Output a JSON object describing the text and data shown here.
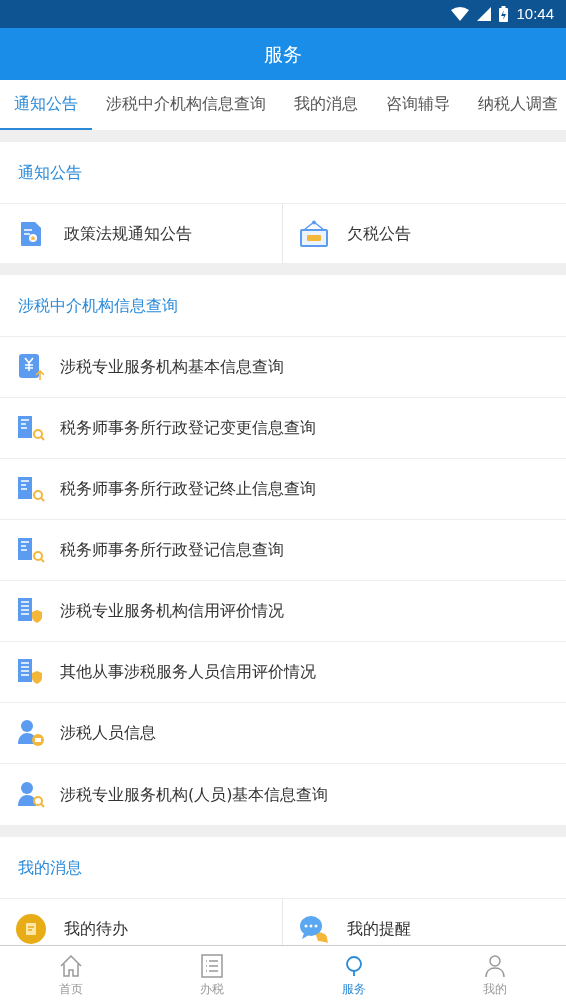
{
  "status_bar": {
    "time": "10:44"
  },
  "header": {
    "title": "服务"
  },
  "tabs": [
    {
      "label": "通知公告",
      "selected": true
    },
    {
      "label": "涉税中介机构信息查询",
      "selected": false
    },
    {
      "label": "我的消息",
      "selected": false
    },
    {
      "label": "咨询辅导",
      "selected": false
    },
    {
      "label": "纳税人调查",
      "selected": false
    }
  ],
  "sections": [
    {
      "title": "通知公告",
      "kind": "grid",
      "items": [
        {
          "label": "政策法规通知公告",
          "kind": "document"
        },
        {
          "label": "欠税公告",
          "kind": "sign"
        }
      ]
    },
    {
      "title": "涉税中介机构信息查询",
      "kind": "list",
      "items": [
        {
          "label": "涉税专业服务机构基本信息查询",
          "kind": "yen"
        },
        {
          "label": "税务师事务所行政登记变更信息查询",
          "kind": "building-search"
        },
        {
          "label": "税务师事务所行政登记终止信息查询",
          "kind": "building-search"
        },
        {
          "label": "税务师事务所行政登记信息查询",
          "kind": "building-search"
        },
        {
          "label": "涉税专业服务机构信用评价情况",
          "kind": "building-shield"
        },
        {
          "label": "其他从事涉税服务人员信用评价情况",
          "kind": "building-shield"
        },
        {
          "label": "涉税人员信息",
          "kind": "person-badge"
        },
        {
          "label": "涉税专业服务机构(人员)基本信息查询",
          "kind": "person-search"
        }
      ]
    },
    {
      "title": "我的消息",
      "kind": "grid",
      "items": [
        {
          "label": "我的待办",
          "kind": "todo"
        },
        {
          "label": "我的提醒",
          "kind": "chat"
        }
      ]
    }
  ],
  "bottom_nav": [
    {
      "label": "首页",
      "kind": "home",
      "selected": false
    },
    {
      "label": "办税",
      "kind": "list",
      "selected": false
    },
    {
      "label": "服务",
      "kind": "service",
      "selected": true
    },
    {
      "label": "我的",
      "kind": "person",
      "selected": false
    }
  ]
}
